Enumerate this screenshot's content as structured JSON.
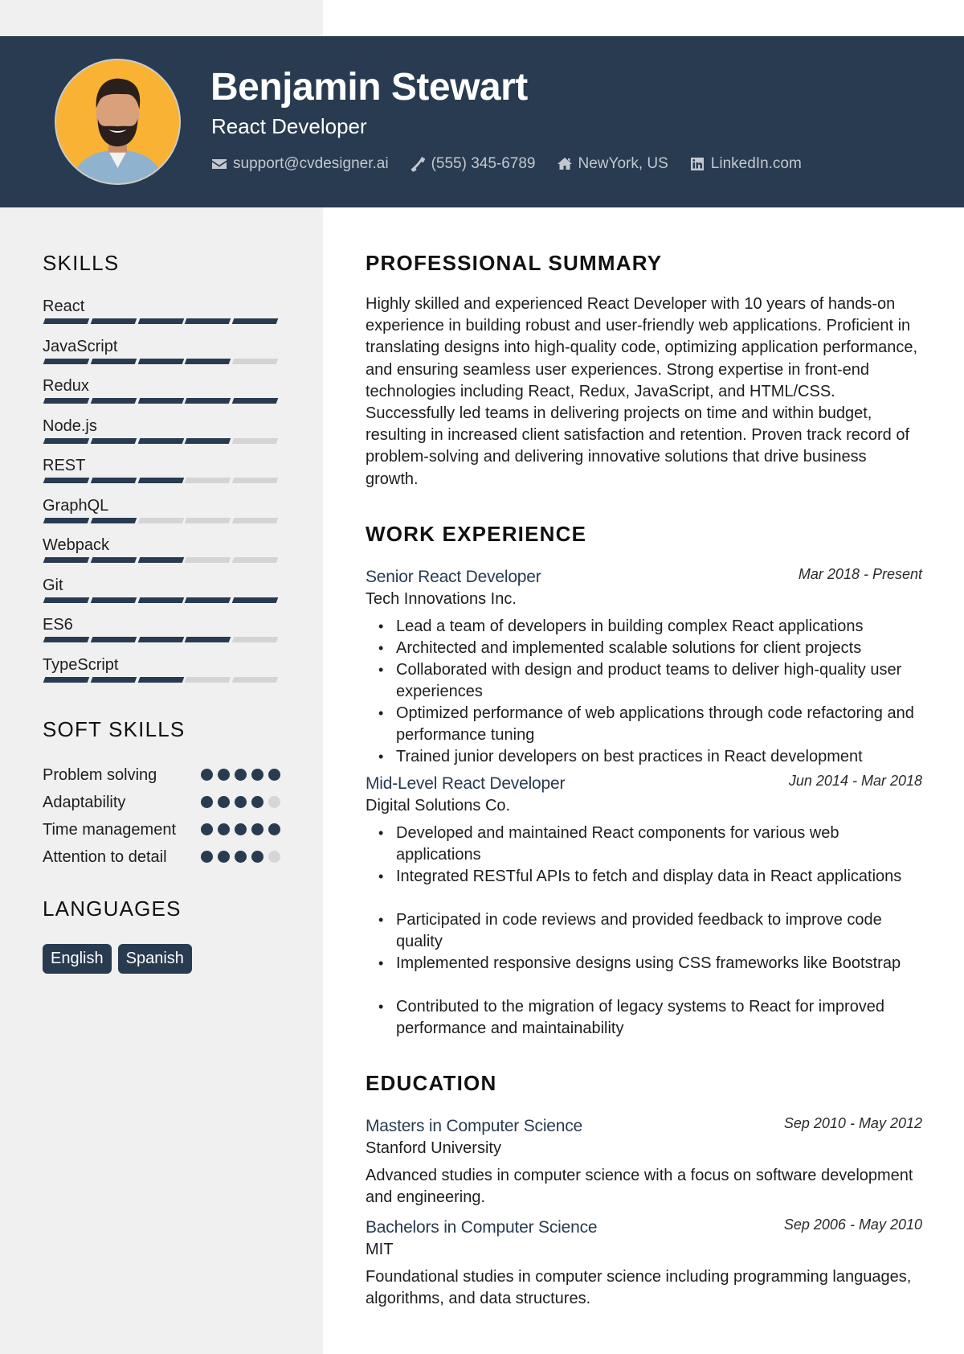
{
  "header": {
    "name": "Benjamin Stewart",
    "role": "React Developer",
    "photo_alt": "Profile photo",
    "contacts": [
      {
        "icon": "envelope-icon",
        "text": "support@cvdesigner.ai"
      },
      {
        "icon": "phone-icon",
        "text": "(555) 345-6789"
      },
      {
        "icon": "home-icon",
        "text": "NewYork, US"
      },
      {
        "icon": "linkedin-icon",
        "text": "LinkedIn.com"
      }
    ]
  },
  "colors": {
    "primary": "#283b50",
    "sidebar_bg": "#f0f0f0",
    "inactive": "#d4d4d4",
    "photo_bg": "#f9b234"
  },
  "sidebar": {
    "skills_heading": "SKILLS",
    "skills_max": 5,
    "skills": [
      {
        "label": "React",
        "level": 5
      },
      {
        "label": "JavaScript",
        "level": 4
      },
      {
        "label": "Redux",
        "level": 5
      },
      {
        "label": "Node.js",
        "level": 4
      },
      {
        "label": "REST",
        "level": 3
      },
      {
        "label": "GraphQL",
        "level": 2
      },
      {
        "label": "Webpack",
        "level": 3
      },
      {
        "label": "Git",
        "level": 5
      },
      {
        "label": "ES6",
        "level": 4
      },
      {
        "label": "TypeScript",
        "level": 3
      }
    ],
    "soft_skills_heading": "SOFT SKILLS",
    "soft_skills": [
      {
        "label": "Problem solving",
        "level": 5
      },
      {
        "label": "Adaptability",
        "level": 4
      },
      {
        "label": "Time management",
        "level": 5
      },
      {
        "label": "Attention to detail",
        "level": 4
      }
    ],
    "languages_heading": "LANGUAGES",
    "languages": [
      "English",
      "Spanish"
    ]
  },
  "main": {
    "summary_heading": "PROFESSIONAL SUMMARY",
    "summary": "Highly skilled and experienced React Developer with 10 years of hands-on experience in building robust and user-friendly web applications. Proficient in translating designs into high-quality code, optimizing application performance, and ensuring seamless user experiences. Strong expertise in front-end technologies including React, Redux, JavaScript, and HTML/CSS. Successfully led teams in delivering projects on time and within budget, resulting in increased client satisfaction and retention. Proven track record of problem-solving and delivering innovative solutions that drive business growth.",
    "work_heading": "WORK EXPERIENCE",
    "jobs": [
      {
        "title": "Senior React Developer",
        "company": "Tech Innovations Inc.",
        "dates": "Mar 2018 - Present",
        "bullets": [
          "Lead a team of developers in building complex React applications",
          "Architected and implemented scalable solutions for client projects",
          "Collaborated with design and product teams to deliver high-quality user experiences",
          "Optimized performance of web applications through code refactoring and performance tuning",
          "Trained junior developers on best practices in React development"
        ]
      },
      {
        "title": "Mid-Level React Developer",
        "company": "Digital Solutions Co.",
        "dates": "Jun 2014 - Mar 2018",
        "bullets": [
          "Developed and maintained React components for various web applications",
          "Integrated RESTful APIs to fetch and display data in React applications",
          "Participated in code reviews and provided feedback to improve code quality",
          "Implemented responsive designs using CSS frameworks like Bootstrap",
          "Contributed to the migration of legacy systems to React for improved performance and maintainability"
        ]
      }
    ],
    "education_heading": "EDUCATION",
    "education": [
      {
        "degree": "Masters in Computer Science",
        "school": "Stanford University",
        "dates": "Sep 2010 - May 2012",
        "description": "Advanced studies in computer science with a focus on software development and engineering."
      },
      {
        "degree": "Bachelors in Computer Science",
        "school": "MIT",
        "dates": "Sep 2006 - May 2010",
        "description": "Foundational studies in computer science including programming languages, algorithms, and data structures."
      }
    ]
  }
}
